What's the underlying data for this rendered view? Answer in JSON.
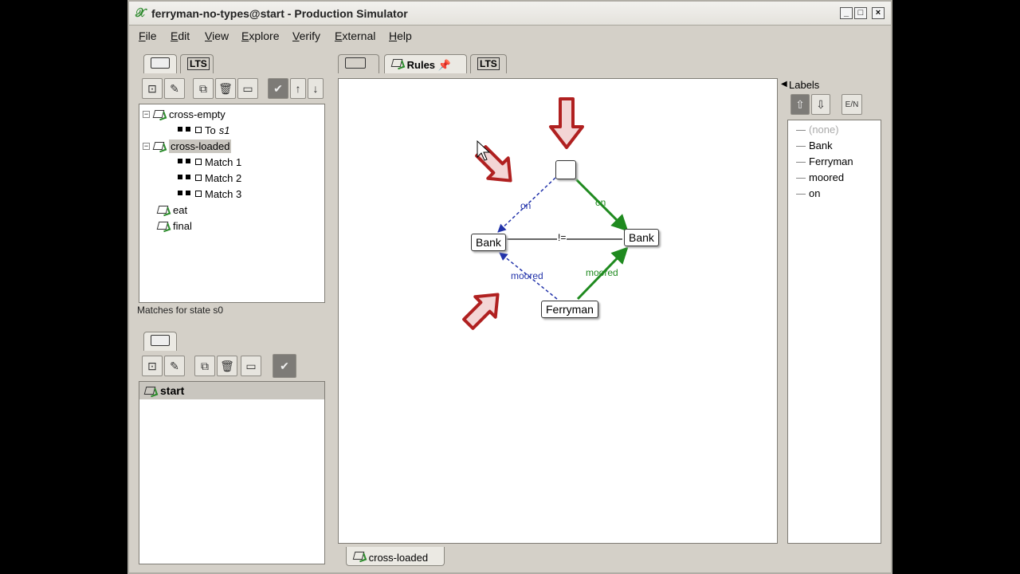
{
  "window": {
    "title": "ferryman-no-types@start - Production Simulator",
    "controls": [
      "_",
      "□",
      "×"
    ]
  },
  "menu": [
    "File",
    "Edit",
    "View",
    "Explore",
    "Verify",
    "External",
    "Help"
  ],
  "left_top": {
    "tabs": [
      {
        "icon": "rule-graph-icon"
      },
      {
        "label": "LTS"
      }
    ],
    "toolbar": [
      "new-rule-icon",
      "edit-rule-icon",
      "copy-icon",
      "delete-icon",
      "rename-icon",
      "enable-icon",
      "move-up-icon",
      "move-down-icon"
    ],
    "tree": [
      {
        "label": "cross-empty",
        "expander": "−"
      },
      {
        "label": "To",
        "suffix": "s1"
      },
      {
        "label": "cross-loaded",
        "expander": "−"
      },
      {
        "label": "Match 1"
      },
      {
        "label": "Match 2"
      },
      {
        "label": "Match 3"
      },
      {
        "label": "eat"
      },
      {
        "label": "final"
      }
    ],
    "status": "Matches for state s0"
  },
  "left_bottom": {
    "tab_icon": "start-graph-icon",
    "toolbar": [
      "new-graph-icon",
      "edit-graph-icon",
      "copy-icon",
      "delete-icon",
      "rename-icon",
      "set-start-icon"
    ],
    "header": "start"
  },
  "main": {
    "tabs": [
      {
        "icon": "graph-icon"
      },
      {
        "label": "Rules"
      },
      {
        "label": "LTS"
      }
    ],
    "bottom_tab": "cross-loaded",
    "graph": {
      "nodes": {
        "bank_left": "Bank",
        "bank_right": "Bank",
        "ferryman": "Ferryman",
        "empty": ""
      },
      "edges": {
        "on_blue": "on",
        "on_green": "on",
        "moored_blue": "moored",
        "moored_green": "moored",
        "neq": "!="
      }
    }
  },
  "labels_panel": {
    "title": "Labels",
    "items": [
      "(none)",
      "Bank",
      "Ferryman",
      "moored",
      "on"
    ]
  }
}
